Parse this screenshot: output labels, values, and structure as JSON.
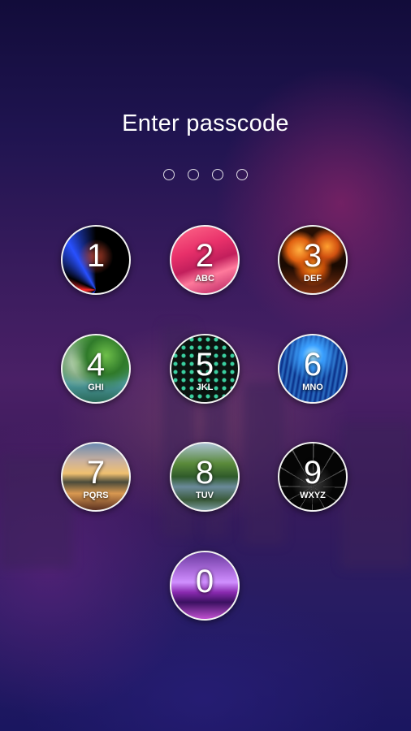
{
  "lockscreen": {
    "title": "Enter passcode",
    "passcode_length": 4,
    "entered_count": 0,
    "keys": [
      {
        "digit": "1",
        "letters": ""
      },
      {
        "digit": "2",
        "letters": "ABC"
      },
      {
        "digit": "3",
        "letters": "DEF"
      },
      {
        "digit": "4",
        "letters": "GHI"
      },
      {
        "digit": "5",
        "letters": "JKL"
      },
      {
        "digit": "6",
        "letters": "MNO"
      },
      {
        "digit": "7",
        "letters": "PQRS"
      },
      {
        "digit": "8",
        "letters": "TUV"
      },
      {
        "digit": "9",
        "letters": "WXYZ"
      },
      {
        "digit": "0",
        "letters": ""
      }
    ]
  },
  "colors": {
    "text": "#ffffff",
    "ring": "#f2f2f2",
    "background_top": "#120c3a",
    "background_mid": "#4a2066",
    "background_bottom": "#1a1660"
  }
}
